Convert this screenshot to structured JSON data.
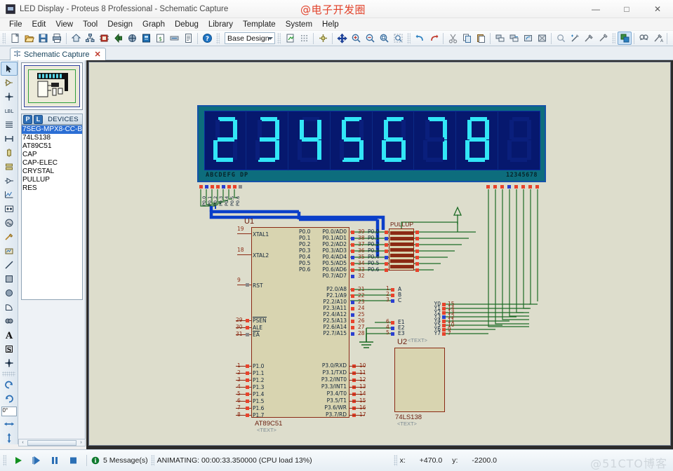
{
  "window": {
    "title": "LED Display - Proteus 8 Professional - Schematic Capture",
    "watermark": "@电子开发圈",
    "minimize": "—",
    "maximize": "□",
    "close": "✕"
  },
  "menu": [
    "File",
    "Edit",
    "View",
    "Tool",
    "Design",
    "Graph",
    "Debug",
    "Library",
    "Template",
    "System",
    "Help"
  ],
  "toolbar": {
    "design_combo_value": "Base Design",
    "icons_group1": [
      "new-file-icon",
      "open-folder-icon",
      "save-icon",
      "print-icon"
    ],
    "icons_group2": [
      "home-icon",
      "hierarchy-icon",
      "bom-icon",
      "back-annotate-icon",
      "netlist-icon",
      "pcb-layout-icon",
      "3d-view-icon",
      "bill-of-materials-icon",
      "report-icon",
      "help-icon"
    ],
    "icons_group3": [
      "refresh-icon",
      "grid-icon",
      "origin-icon",
      "pan-icon",
      "zoom-in-icon",
      "zoom-out-icon",
      "zoom-all-icon",
      "zoom-area-icon"
    ],
    "icons_group4": [
      "undo-icon",
      "redo-icon",
      "cut-icon",
      "copy-icon",
      "paste-icon",
      "block-copy-icon",
      "block-move-icon",
      "block-rotate-icon",
      "block-delete-icon",
      "pick-device-icon",
      "make-device-icon",
      "packaging-tool-icon",
      "decompose-icon"
    ],
    "icons_group5": [
      "toggle-real-time-icon",
      "property-search-icon",
      "property-assign-icon",
      "new-sheet-icon",
      "remove-sheet-icon",
      "sheet-config-icon",
      "zoom-sheet-icon"
    ]
  },
  "tabs": [
    {
      "label": "Schematic Capture",
      "icon": "schematic-icon",
      "close": "✕"
    }
  ],
  "rail": {
    "tools": [
      "selection-mode-icon",
      "component-mode-icon",
      "junction-dot-icon",
      "wire-label-icon",
      "text-script-icon",
      "buses-icon",
      "subcircuit-icon",
      "terminals-mode-icon",
      "device-pins-icon",
      "graph-mode-icon",
      "tape-recorder-icon",
      "generator-mode-icon",
      "voltage-probe-icon",
      "current-probe-icon",
      "virtual-instruments-icon",
      "line-tool-icon",
      "box-tool-icon",
      "circle-tool-icon",
      "arc-tool-icon",
      "path-tool-icon",
      "text-tool-icon",
      "symbols-tool-icon",
      "markers-tool-icon"
    ],
    "rotate_clockwise": "rotate-cw-icon",
    "rotate_counter": "rotate-ccw-icon",
    "rotation_value": "0°",
    "mirror_x": "mirror-horizontal-icon",
    "mirror_y": "mirror-vertical-icon"
  },
  "devices_panel": {
    "btn_p": "P",
    "btn_l": "L",
    "header": "DEVICES",
    "items": [
      "7SEG-MPX8-CC-BLUE",
      "74LS138",
      "AT89C51",
      "CAP",
      "CAP-ELEC",
      "CRYSTAL",
      "PULLUP",
      "RES"
    ],
    "selected_index": 0,
    "scroll_left": "‹",
    "scroll_right": "›"
  },
  "schematic": {
    "display": {
      "part": "7SEG-MPX8-CC-BLUE",
      "segment_labels": "ABCDEFG DP",
      "digit_labels": "12345678",
      "digits": [
        "2",
        "3",
        "4",
        "5",
        "6",
        "7",
        "8",
        " "
      ],
      "segment_pin_nets": [
        "P0.0",
        "P0.1",
        "P0.2",
        "P0.3",
        "P0.4",
        "P0.5",
        "P0.6"
      ]
    },
    "u1": {
      "refdes": "U1",
      "part": "AT89C51",
      "text": "<TEXT>",
      "left_pins": [
        {
          "num": "19",
          "name": "XTAL1"
        },
        {
          "num": "18",
          "name": "XTAL2"
        },
        {
          "num": "9",
          "name": "RST"
        },
        {
          "num": "29",
          "name": "PSEN"
        },
        {
          "num": "30",
          "name": "ALE"
        },
        {
          "num": "31",
          "name": "EA"
        },
        {
          "num": "1",
          "name": "P1.0"
        },
        {
          "num": "2",
          "name": "P1.1"
        },
        {
          "num": "3",
          "name": "P1.2"
        },
        {
          "num": "4",
          "name": "P1.3"
        },
        {
          "num": "5",
          "name": "P1.4"
        },
        {
          "num": "6",
          "name": "P1.5"
        },
        {
          "num": "7",
          "name": "P1.6"
        },
        {
          "num": "8",
          "name": "P1.7"
        }
      ],
      "right_pins_p0": [
        {
          "num": "39",
          "name": "P0.0/AD0"
        },
        {
          "num": "38",
          "name": "P0.1/AD1"
        },
        {
          "num": "37",
          "name": "P0.2/AD2"
        },
        {
          "num": "36",
          "name": "P0.3/AD3"
        },
        {
          "num": "35",
          "name": "P0.4/AD4"
        },
        {
          "num": "34",
          "name": "P0.5/AD5"
        },
        {
          "num": "33",
          "name": "P0.6/AD6"
        },
        {
          "num": "32",
          "name": "P0.7/AD7"
        }
      ],
      "right_pins_p2": [
        {
          "num": "21",
          "name": "P2.0/A8"
        },
        {
          "num": "22",
          "name": "P2.1/A9"
        },
        {
          "num": "23",
          "name": "P2.2/A10"
        },
        {
          "num": "24",
          "name": "P2.3/A11"
        },
        {
          "num": "25",
          "name": "P2.4/A12"
        },
        {
          "num": "26",
          "name": "P2.5/A13"
        },
        {
          "num": "27",
          "name": "P2.6/A14"
        },
        {
          "num": "28",
          "name": "P2.7/A15"
        }
      ],
      "right_pins_p3": [
        {
          "num": "10",
          "name": "P3.0/RXD"
        },
        {
          "num": "11",
          "name": "P3.1/TXD"
        },
        {
          "num": "12",
          "name": "P3.2/INT0"
        },
        {
          "num": "13",
          "name": "P3.3/INT1"
        },
        {
          "num": "14",
          "name": "P3.4/T0"
        },
        {
          "num": "15",
          "name": "P3.5/T1"
        },
        {
          "num": "16",
          "name": "P3.6/WR"
        },
        {
          "num": "17",
          "name": "P3.7/RD"
        }
      ]
    },
    "u2": {
      "refdes": "U2",
      "part": "74LS138",
      "text": "<TEXT>",
      "left_pins": [
        {
          "num": "1",
          "name": "A"
        },
        {
          "num": "2",
          "name": "B"
        },
        {
          "num": "3",
          "name": "C"
        },
        {
          "num": "6",
          "name": "E1"
        },
        {
          "num": "4",
          "name": "E2"
        },
        {
          "num": "5",
          "name": "E3"
        }
      ],
      "right_pins": [
        {
          "num": "15",
          "name": "Y0"
        },
        {
          "num": "14",
          "name": "Y1"
        },
        {
          "num": "13",
          "name": "Y2"
        },
        {
          "num": "12",
          "name": "Y3"
        },
        {
          "num": "11",
          "name": "Y4"
        },
        {
          "num": "10",
          "name": "Y5"
        },
        {
          "num": "9",
          "name": "Y6"
        },
        {
          "num": "7",
          "name": "Y7"
        }
      ]
    },
    "pullup": {
      "label": "PULLUP",
      "nets": [
        "P0.0",
        "P0.1",
        "P0.2",
        "P0.3",
        "P0.4",
        "P0.5",
        "P0.6"
      ]
    },
    "bus_nets": [
      "P0.0",
      "P0.1",
      "P0.2",
      "P0.3",
      "P0.4",
      "P0.5",
      "P0.6"
    ],
    "ground_symbol": "ground-icon",
    "power_symbol": "power-rail-icon"
  },
  "statusbar": {
    "play": "play-icon",
    "step": "step-icon",
    "pause": "pause-icon",
    "stop": "stop-icon",
    "messages_icon": "info-icon",
    "messages": "5 Message(s)",
    "animating": "ANIMATING: 00:00:33.350000 (CPU load 13%)",
    "x_label": "x:",
    "x_value": "+470.0",
    "y_label": "y:",
    "y_value": "-2200.0",
    "watermark": "@51CTO博客"
  }
}
